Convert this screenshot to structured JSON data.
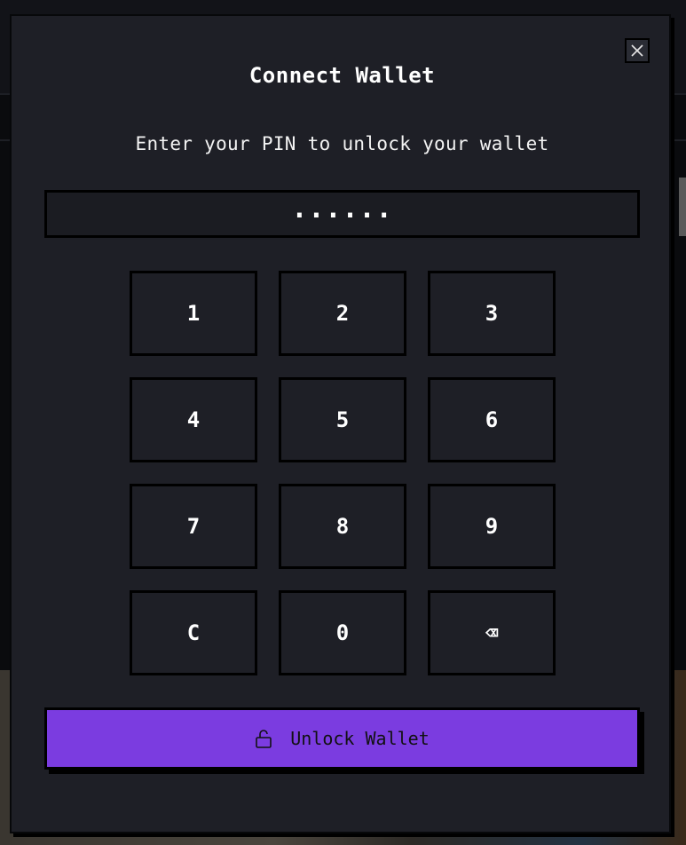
{
  "modal": {
    "title": "Connect Wallet",
    "subtitle": "Enter your PIN to unlock your wallet",
    "pin_display": "......",
    "close_icon": "close-icon"
  },
  "keypad": {
    "keys": [
      "1",
      "2",
      "3",
      "4",
      "5",
      "6",
      "7",
      "8",
      "9",
      "C",
      "0",
      "⌫"
    ]
  },
  "unlock_button": {
    "label": "Unlock Wallet",
    "icon": "unlock-icon"
  },
  "colors": {
    "modal_bg": "#1e1f26",
    "accent": "#7b3ce0",
    "border": "#000000",
    "text": "#ffffff"
  }
}
